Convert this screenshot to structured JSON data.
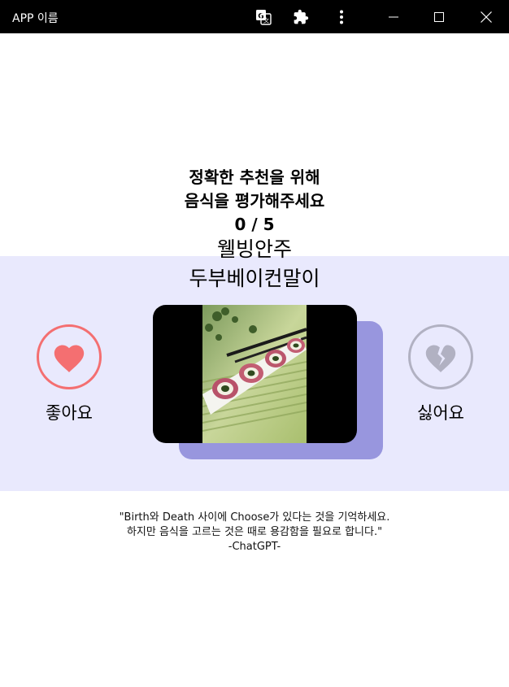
{
  "window": {
    "title": "APP 이름",
    "icons": [
      "translate-icon",
      "extension-icon",
      "more-vert-icon",
      "minimize-icon",
      "maximize-icon",
      "close-icon"
    ]
  },
  "header": {
    "line1": "정확한 추천을 위해",
    "line2": "음식을 평가해주세요",
    "progress": "0 / 5"
  },
  "food": {
    "category": "웰빙안주",
    "name": "두부베이컨말이"
  },
  "choices": {
    "like_label": "좋아요",
    "dislike_label": "싫어요"
  },
  "quote": {
    "line1": "\"Birth와 Death 사이에 Choose가 있다는 것을 기억하세요.",
    "line2": "하지만 음식을 고르는 것은 때로 용감함을 필요로 합니다.\"",
    "author": "-ChatGPT-"
  },
  "colors": {
    "band": "#e9e9fd",
    "card_shadow": "#9896de",
    "like": "#f46f71",
    "dislike": "#b1b1c2"
  }
}
